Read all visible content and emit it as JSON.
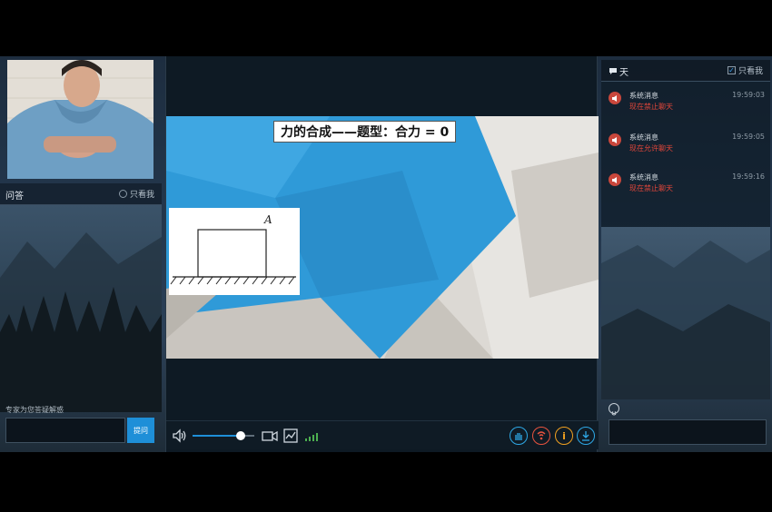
{
  "qa": {
    "title": "问答",
    "only_me_label": "只看我",
    "hint": "专家为您答疑解惑",
    "input_placeholder": "",
    "submit_label": "提问"
  },
  "slide": {
    "title": "力的合成——题型：合力 = 0",
    "figure_label": "A"
  },
  "controls": {
    "volume_fraction": 0.78,
    "icons": [
      "volume-icon",
      "camera-icon",
      "screen-share-icon",
      "signal-icon",
      "raise-hand-icon",
      "network-icon",
      "info-icon",
      "download-icon"
    ],
    "colors": {
      "raise_hand": "#2ea8e6",
      "network": "#e8533f",
      "info": "#f0a020",
      "download": "#2ea8e6"
    }
  },
  "chat": {
    "title": "天",
    "only_me_label": "只看我",
    "only_me_checked": true,
    "messages": [
      {
        "sender": "系统消息",
        "time": "19:59:03",
        "text": "现在禁止聊天"
      },
      {
        "sender": "系统消息",
        "time": "19:59:05",
        "text": "现在允许聊天"
      },
      {
        "sender": "系统消息",
        "time": "19:59:16",
        "text": "现在禁止聊天"
      }
    ],
    "input_placeholder": ""
  }
}
